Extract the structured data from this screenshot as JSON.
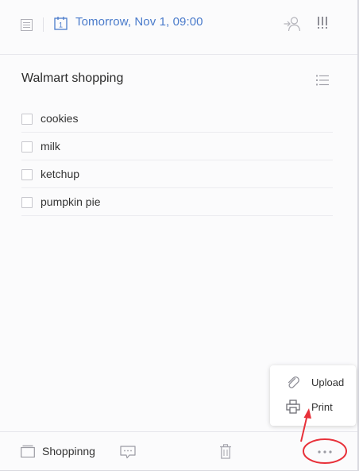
{
  "header": {
    "date_label": "Tomorrow,  Nov 1, 09:00",
    "calendar_day": "1",
    "icons": {
      "task_detail": "note-icon",
      "calendar": "calendar-icon",
      "assign": "assign-user-icon",
      "priority": "priority-icon"
    }
  },
  "task": {
    "title": "Walmart shopping",
    "checklist_icon": "checklist-icon",
    "items": [
      {
        "label": "cookies",
        "checked": false
      },
      {
        "label": "milk",
        "checked": false
      },
      {
        "label": "ketchup",
        "checked": false
      },
      {
        "label": "pumpkin pie",
        "checked": false
      }
    ]
  },
  "popup_menu": {
    "items": [
      {
        "label": "Upload",
        "icon": "paperclip-icon"
      },
      {
        "label": "Print",
        "icon": "printer-icon"
      }
    ]
  },
  "footer": {
    "list_name": "Shoppinng",
    "icons": {
      "list": "list-folder-icon",
      "comment": "comment-icon",
      "delete": "trash-icon",
      "more": "more-dots-icon"
    }
  },
  "colors": {
    "accent_blue": "#4a7bcb",
    "annotation_red": "#e8313a",
    "icon_gray": "#9a9aa2"
  }
}
